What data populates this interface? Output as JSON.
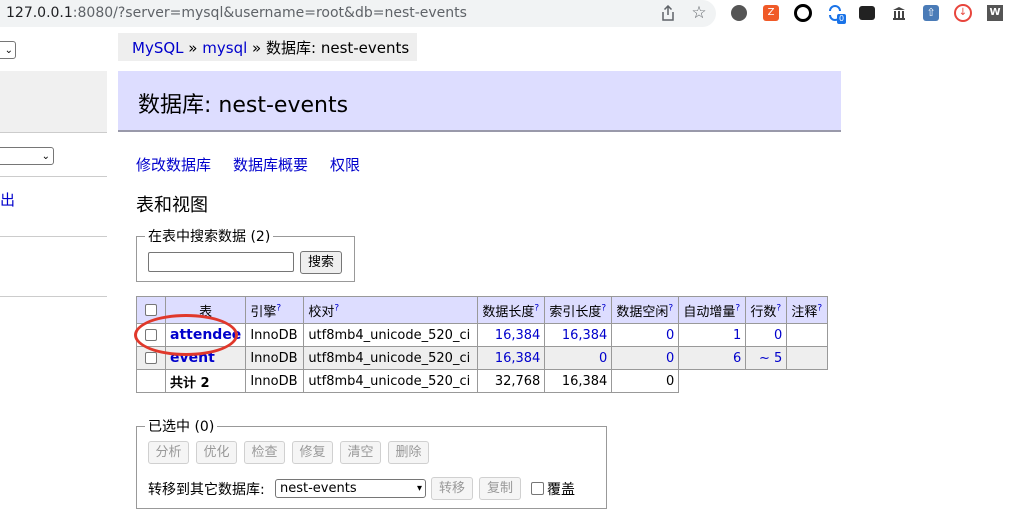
{
  "browser": {
    "url_host": "127.0.0.1",
    "url_rest": ":8080/?server=mysql&username=root&db=nest-events",
    "toolbar_icons": [
      "share-icon",
      "bookmark-star-icon",
      "extension-icon",
      "extension-icon",
      "extension-icon",
      "extension-icon",
      "extension-icon",
      "extension-icon",
      "extension-icon",
      "extension-icon",
      "extension-icon"
    ],
    "badge_count": "0"
  },
  "sidebar": {
    "logout_label": "出"
  },
  "breadcrumb": {
    "part1": "MySQL",
    "sep": "»",
    "part2": "mysql",
    "current": "数据库: nest-events"
  },
  "header": {
    "title": "数据库: nest-events"
  },
  "tabs": {
    "alter": "修改数据库",
    "schema": "数据库概要",
    "privileges": "权限"
  },
  "section_title": "表和视图",
  "search": {
    "legend": "在表中搜索数据 (2)",
    "button": "搜索",
    "value": ""
  },
  "table": {
    "headers": [
      "表",
      "引擎",
      "校对",
      "数据长度",
      "索引长度",
      "数据空闲",
      "自动增量",
      "行数",
      "注释"
    ],
    "help_mark": "?",
    "rows": [
      {
        "name": "attendee",
        "engine": "InnoDB",
        "collation": "utf8mb4_unicode_520_ci",
        "data_length": "16,384",
        "index_length": "16,384",
        "data_free": "0",
        "auto_increment": "1",
        "rows": "0",
        "comment": ""
      },
      {
        "name": "event",
        "engine": "InnoDB",
        "collation": "utf8mb4_unicode_520_ci",
        "data_length": "16,384",
        "index_length": "0",
        "data_free": "0",
        "auto_increment": "6",
        "rows": "~ 5",
        "comment": ""
      }
    ],
    "total": {
      "label": "共计 2",
      "engine": "InnoDB",
      "collation": "utf8mb4_unicode_520_ci",
      "data_length": "32,768",
      "index_length": "16,384",
      "data_free": "0"
    }
  },
  "selection": {
    "legend": "已选中 (0)",
    "buttons": [
      "分析",
      "优化",
      "检查",
      "修复",
      "清空",
      "删除"
    ],
    "move_label": "转移到其它数据库:",
    "db_selected": "nest-events",
    "move_button": "转移",
    "copy_button": "复制",
    "overwrite_label": "覆盖"
  }
}
